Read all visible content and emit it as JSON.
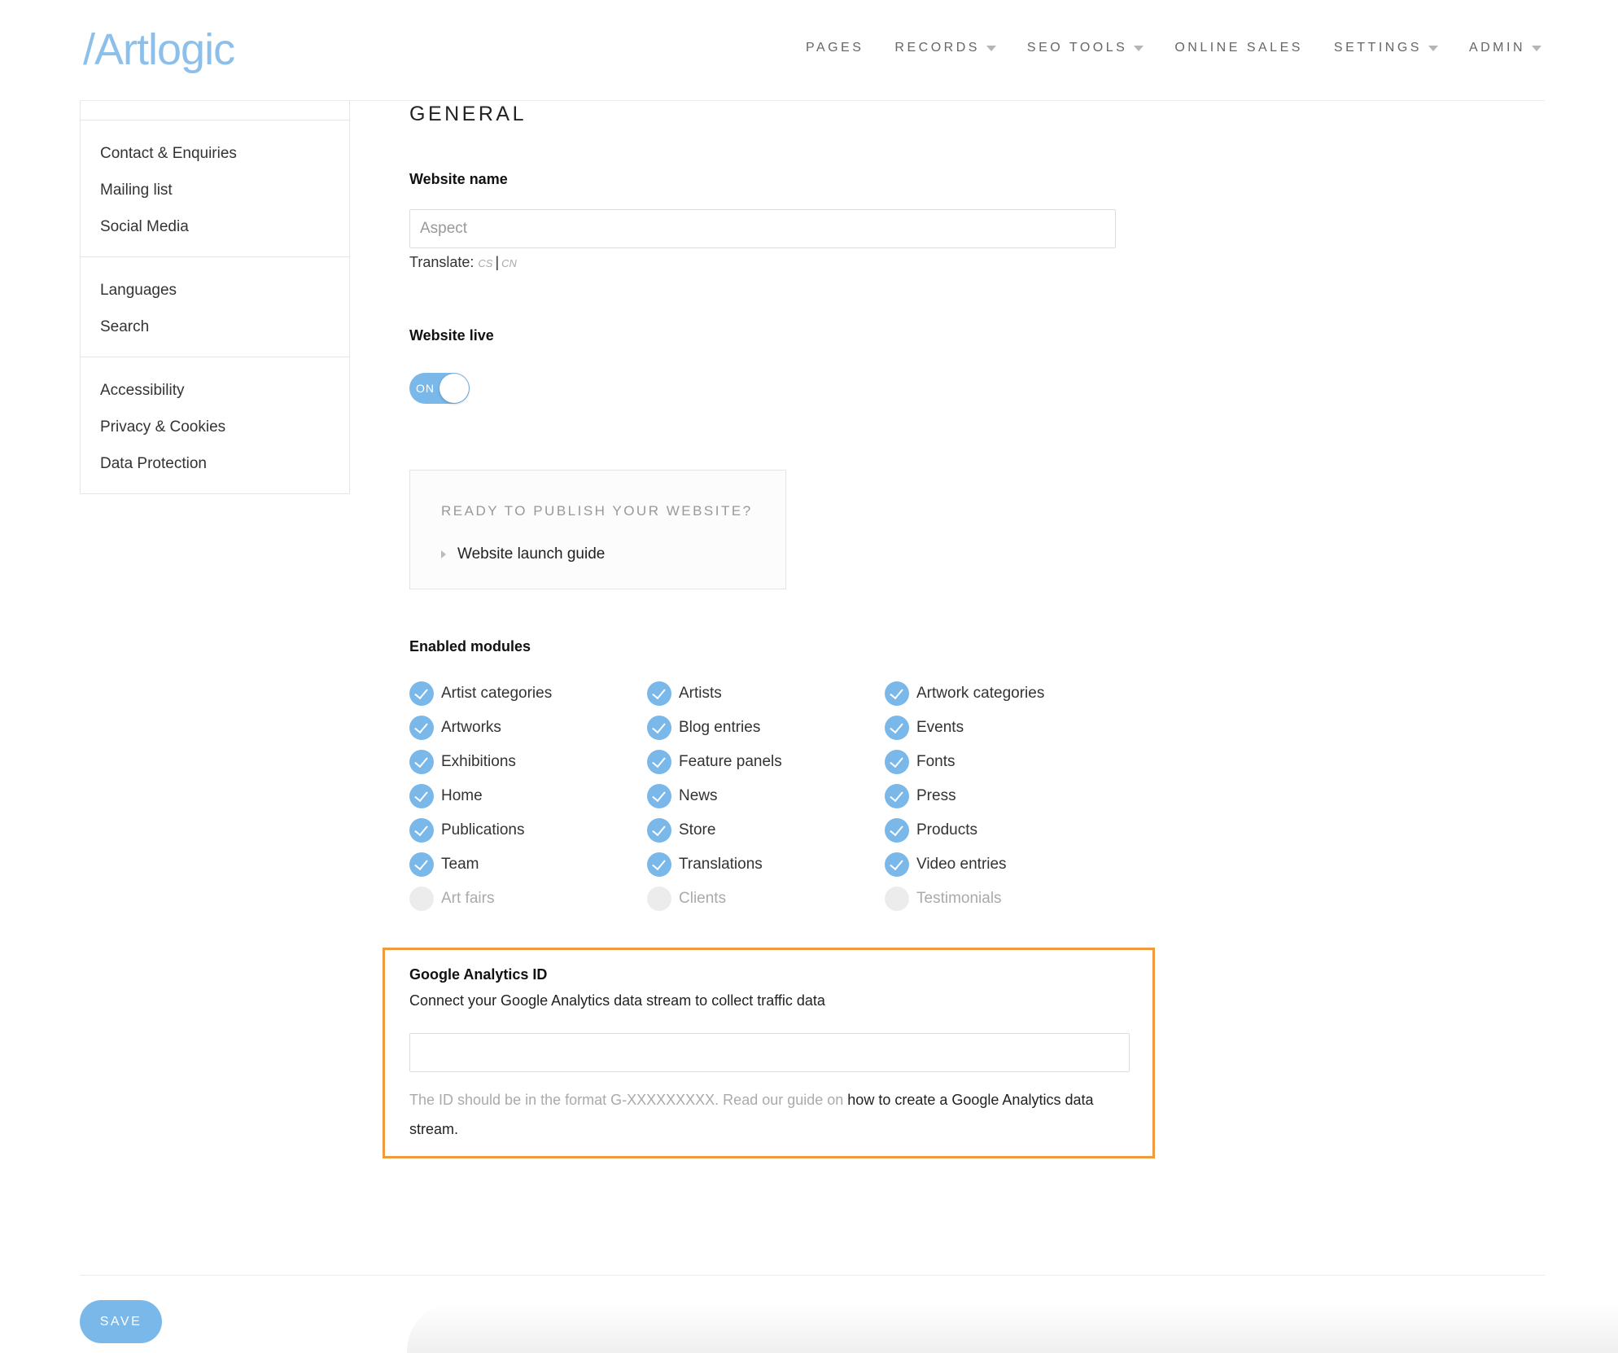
{
  "brand": {
    "logo_text": "/Artlogic",
    "accent_color": "#7bb8ea",
    "highlight_color": "#ef9a3c"
  },
  "nav": {
    "items": [
      {
        "label": "PAGES",
        "has_dropdown": false
      },
      {
        "label": "RECORDS",
        "has_dropdown": true
      },
      {
        "label": "SEO TOOLS",
        "has_dropdown": true
      },
      {
        "label": "ONLINE SALES",
        "has_dropdown": false
      },
      {
        "label": "SETTINGS",
        "has_dropdown": true
      },
      {
        "label": "ADMIN",
        "has_dropdown": true
      }
    ]
  },
  "sidebar": {
    "groups": [
      {
        "items": [
          {
            "label": "Contact & Enquiries"
          },
          {
            "label": "Mailing list"
          },
          {
            "label": "Social Media"
          }
        ]
      },
      {
        "items": [
          {
            "label": "Languages"
          },
          {
            "label": "Search"
          }
        ]
      },
      {
        "items": [
          {
            "label": "Accessibility"
          },
          {
            "label": "Privacy & Cookies"
          },
          {
            "label": "Data Protection"
          }
        ]
      }
    ]
  },
  "main": {
    "section_title": "GENERAL",
    "website_name": {
      "label": "Website name",
      "value": "Aspect",
      "translate_label": "Translate:",
      "languages": [
        "CS",
        "CN"
      ],
      "separator": "|"
    },
    "website_live": {
      "label": "Website live",
      "state_label": "ON",
      "is_on": true
    },
    "publish": {
      "title": "READY TO PUBLISH YOUR WEBSITE?",
      "link_label": "Website launch guide"
    },
    "modules": {
      "label": "Enabled modules",
      "items": [
        {
          "label": "Artist categories",
          "enabled": true
        },
        {
          "label": "Artists",
          "enabled": true
        },
        {
          "label": "Artwork categories",
          "enabled": true
        },
        {
          "label": "Artworks",
          "enabled": true
        },
        {
          "label": "Blog entries",
          "enabled": true
        },
        {
          "label": "Events",
          "enabled": true
        },
        {
          "label": "Exhibitions",
          "enabled": true
        },
        {
          "label": "Feature panels",
          "enabled": true
        },
        {
          "label": "Fonts",
          "enabled": true
        },
        {
          "label": "Home",
          "enabled": true
        },
        {
          "label": "News",
          "enabled": true
        },
        {
          "label": "Press",
          "enabled": true
        },
        {
          "label": "Publications",
          "enabled": true
        },
        {
          "label": "Store",
          "enabled": true
        },
        {
          "label": "Products",
          "enabled": true
        },
        {
          "label": "Team",
          "enabled": true
        },
        {
          "label": "Translations",
          "enabled": true
        },
        {
          "label": "Video entries",
          "enabled": true
        },
        {
          "label": "Art fairs",
          "enabled": false
        },
        {
          "label": "Clients",
          "enabled": false
        },
        {
          "label": "Testimonials",
          "enabled": false
        }
      ]
    },
    "google_analytics": {
      "label": "Google Analytics ID",
      "description": "Connect your Google Analytics data stream to collect traffic data",
      "value": "",
      "help_text": "The ID should be in the format G-XXXXXXXXX. Read our guide on ",
      "help_link": "how to create a Google Analytics data stream."
    }
  },
  "footer": {
    "save_label": "SAVE"
  }
}
